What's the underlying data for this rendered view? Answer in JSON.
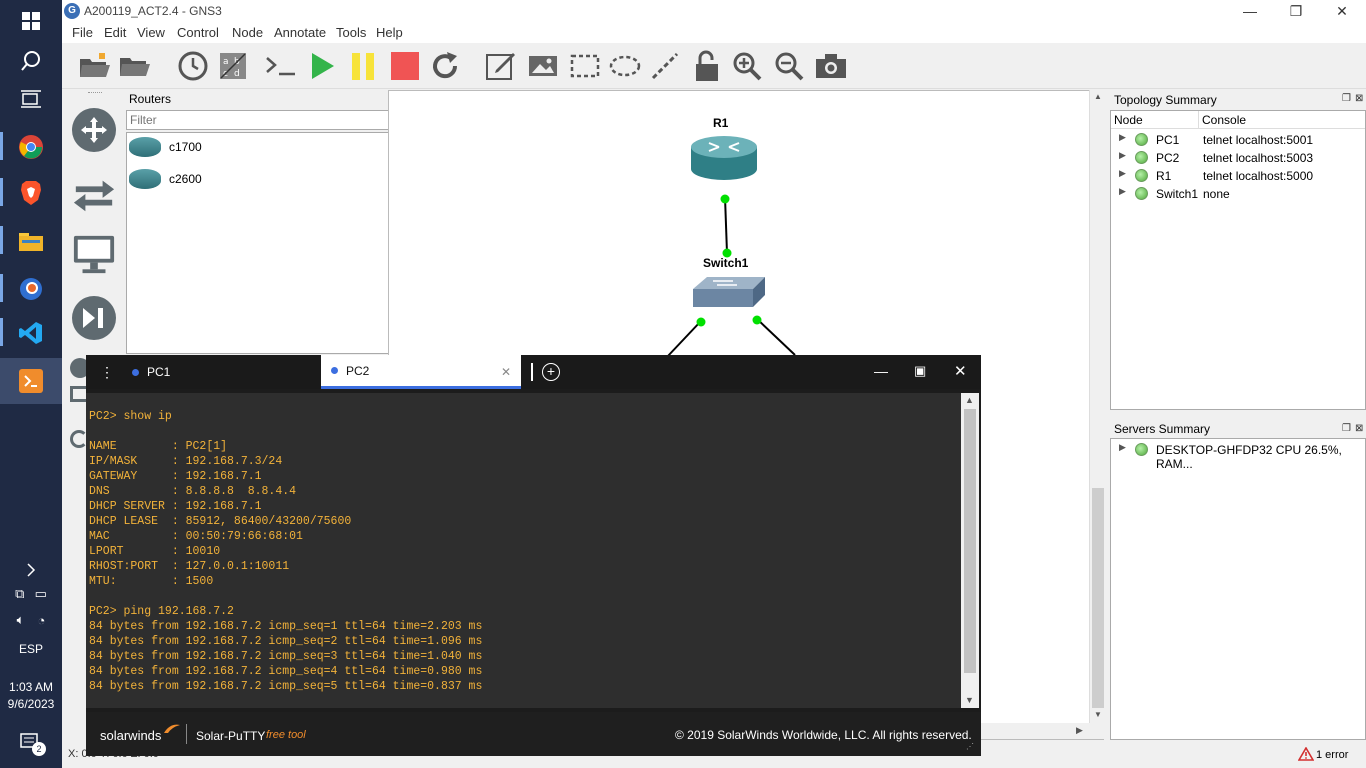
{
  "taskbar": {
    "clock_time": "1:03 AM",
    "clock_date": "9/6/2023",
    "language": "ESP",
    "notification_count": "2"
  },
  "window": {
    "title": "A200119_ACT2.4 - GNS3"
  },
  "menu": [
    "File",
    "Edit",
    "View",
    "Control",
    "Node",
    "Annotate",
    "Tools",
    "Help"
  ],
  "routers_dock": {
    "title": "Routers",
    "filter_placeholder": "Filter",
    "items": [
      "c1700",
      "c2600"
    ]
  },
  "topology": {
    "nodes": [
      {
        "label": "R1"
      },
      {
        "label": "Switch1"
      }
    ]
  },
  "topology_summary": {
    "title": "Topology Summary",
    "col_node": "Node",
    "col_console": "Console",
    "rows": [
      {
        "node": "PC1",
        "console": "telnet localhost:5001"
      },
      {
        "node": "PC2",
        "console": "telnet localhost:5003"
      },
      {
        "node": "R1",
        "console": "telnet localhost:5000"
      },
      {
        "node": "Switch1",
        "console": "none"
      }
    ]
  },
  "servers_summary": {
    "title": "Servers Summary",
    "server": "DESKTOP-GHFDP32 CPU 26.5%, RAM..."
  },
  "statusbar": {
    "coords": "X: 0.0 Y: 0.0 Z: 0.0",
    "errors": "1 error"
  },
  "putty": {
    "tabs": [
      {
        "label": "PC1",
        "active": false
      },
      {
        "label": "PC2",
        "active": true
      }
    ],
    "brand": "solarwinds",
    "product": "Solar-PuTTY",
    "product_tag": "free tool",
    "copyright": "© 2019 SolarWinds Worldwide, LLC. All rights reserved.",
    "terminal_lines": [
      "PC2> show ip",
      "",
      "NAME        : PC2[1]",
      "IP/MASK     : 192.168.7.3/24",
      "GATEWAY     : 192.168.7.1",
      "DNS         : 8.8.8.8  8.8.4.4",
      "DHCP SERVER : 192.168.7.1",
      "DHCP LEASE  : 85912, 86400/43200/75600",
      "MAC         : 00:50:79:66:68:01",
      "LPORT       : 10010",
      "RHOST:PORT  : 127.0.0.1:10011",
      "MTU:        : 1500",
      "",
      "PC2> ping 192.168.7.2",
      "84 bytes from 192.168.7.2 icmp_seq=1 ttl=64 time=2.203 ms",
      "84 bytes from 192.168.7.2 icmp_seq=2 ttl=64 time=1.096 ms",
      "84 bytes from 192.168.7.2 icmp_seq=3 ttl=64 time=1.040 ms",
      "84 bytes from 192.168.7.2 icmp_seq=4 ttl=64 time=0.980 ms",
      "84 bytes from 192.168.7.2 icmp_seq=5 ttl=64 time=0.837 ms"
    ]
  },
  "colors": {
    "terminal_text": "#f2b23a",
    "putty_tab_active": "#ffffff",
    "link_dot": "#00e000"
  }
}
